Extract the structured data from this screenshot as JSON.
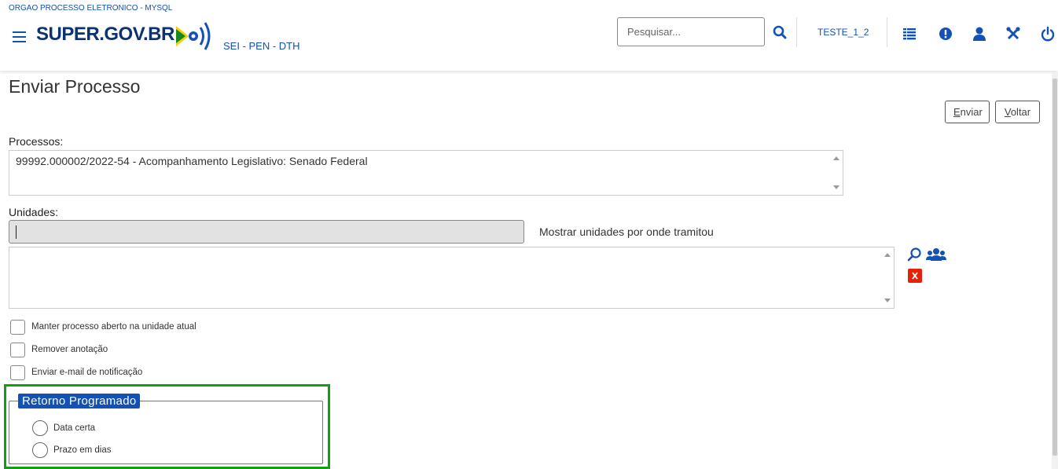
{
  "header": {
    "org_name": "ORGAO PROCESSO ELETRONICO - MYSQL",
    "logo_text": "SUPER.GOV.BR",
    "subtitle": "SEI - PEN - DTH",
    "search_placeholder": "Pesquisar...",
    "user": "TESTE_1_2",
    "icons": [
      "menu-icon",
      "search-icon",
      "list-icon",
      "alert-icon",
      "user-icon",
      "tools-icon",
      "power-icon"
    ],
    "accent_color": "#1351b4"
  },
  "page": {
    "title": "Enviar Processo",
    "buttons": {
      "send_first": "E",
      "send_rest": "nviar",
      "back_first": "V",
      "back_rest": "oltar"
    }
  },
  "form": {
    "processes_label": "Processos:",
    "processes": [
      "99992.000002/2022-54 - Acompanhamento Legislativo: Senado Federal"
    ],
    "units_label": "Unidades:",
    "units_input_value": "",
    "show_units_label": "Mostrar unidades por onde tramitou",
    "checkboxes": [
      {
        "label": "Manter processo aberto na unidade atual",
        "checked": false
      },
      {
        "label": "Remover anotação",
        "checked": false
      },
      {
        "label": "Enviar e-mail de notificação",
        "checked": false
      }
    ],
    "return": {
      "legend": "Retorno Programado",
      "options": [
        {
          "label": "Data certa",
          "selected": false
        },
        {
          "label": "Prazo em dias",
          "selected": false
        }
      ]
    }
  }
}
